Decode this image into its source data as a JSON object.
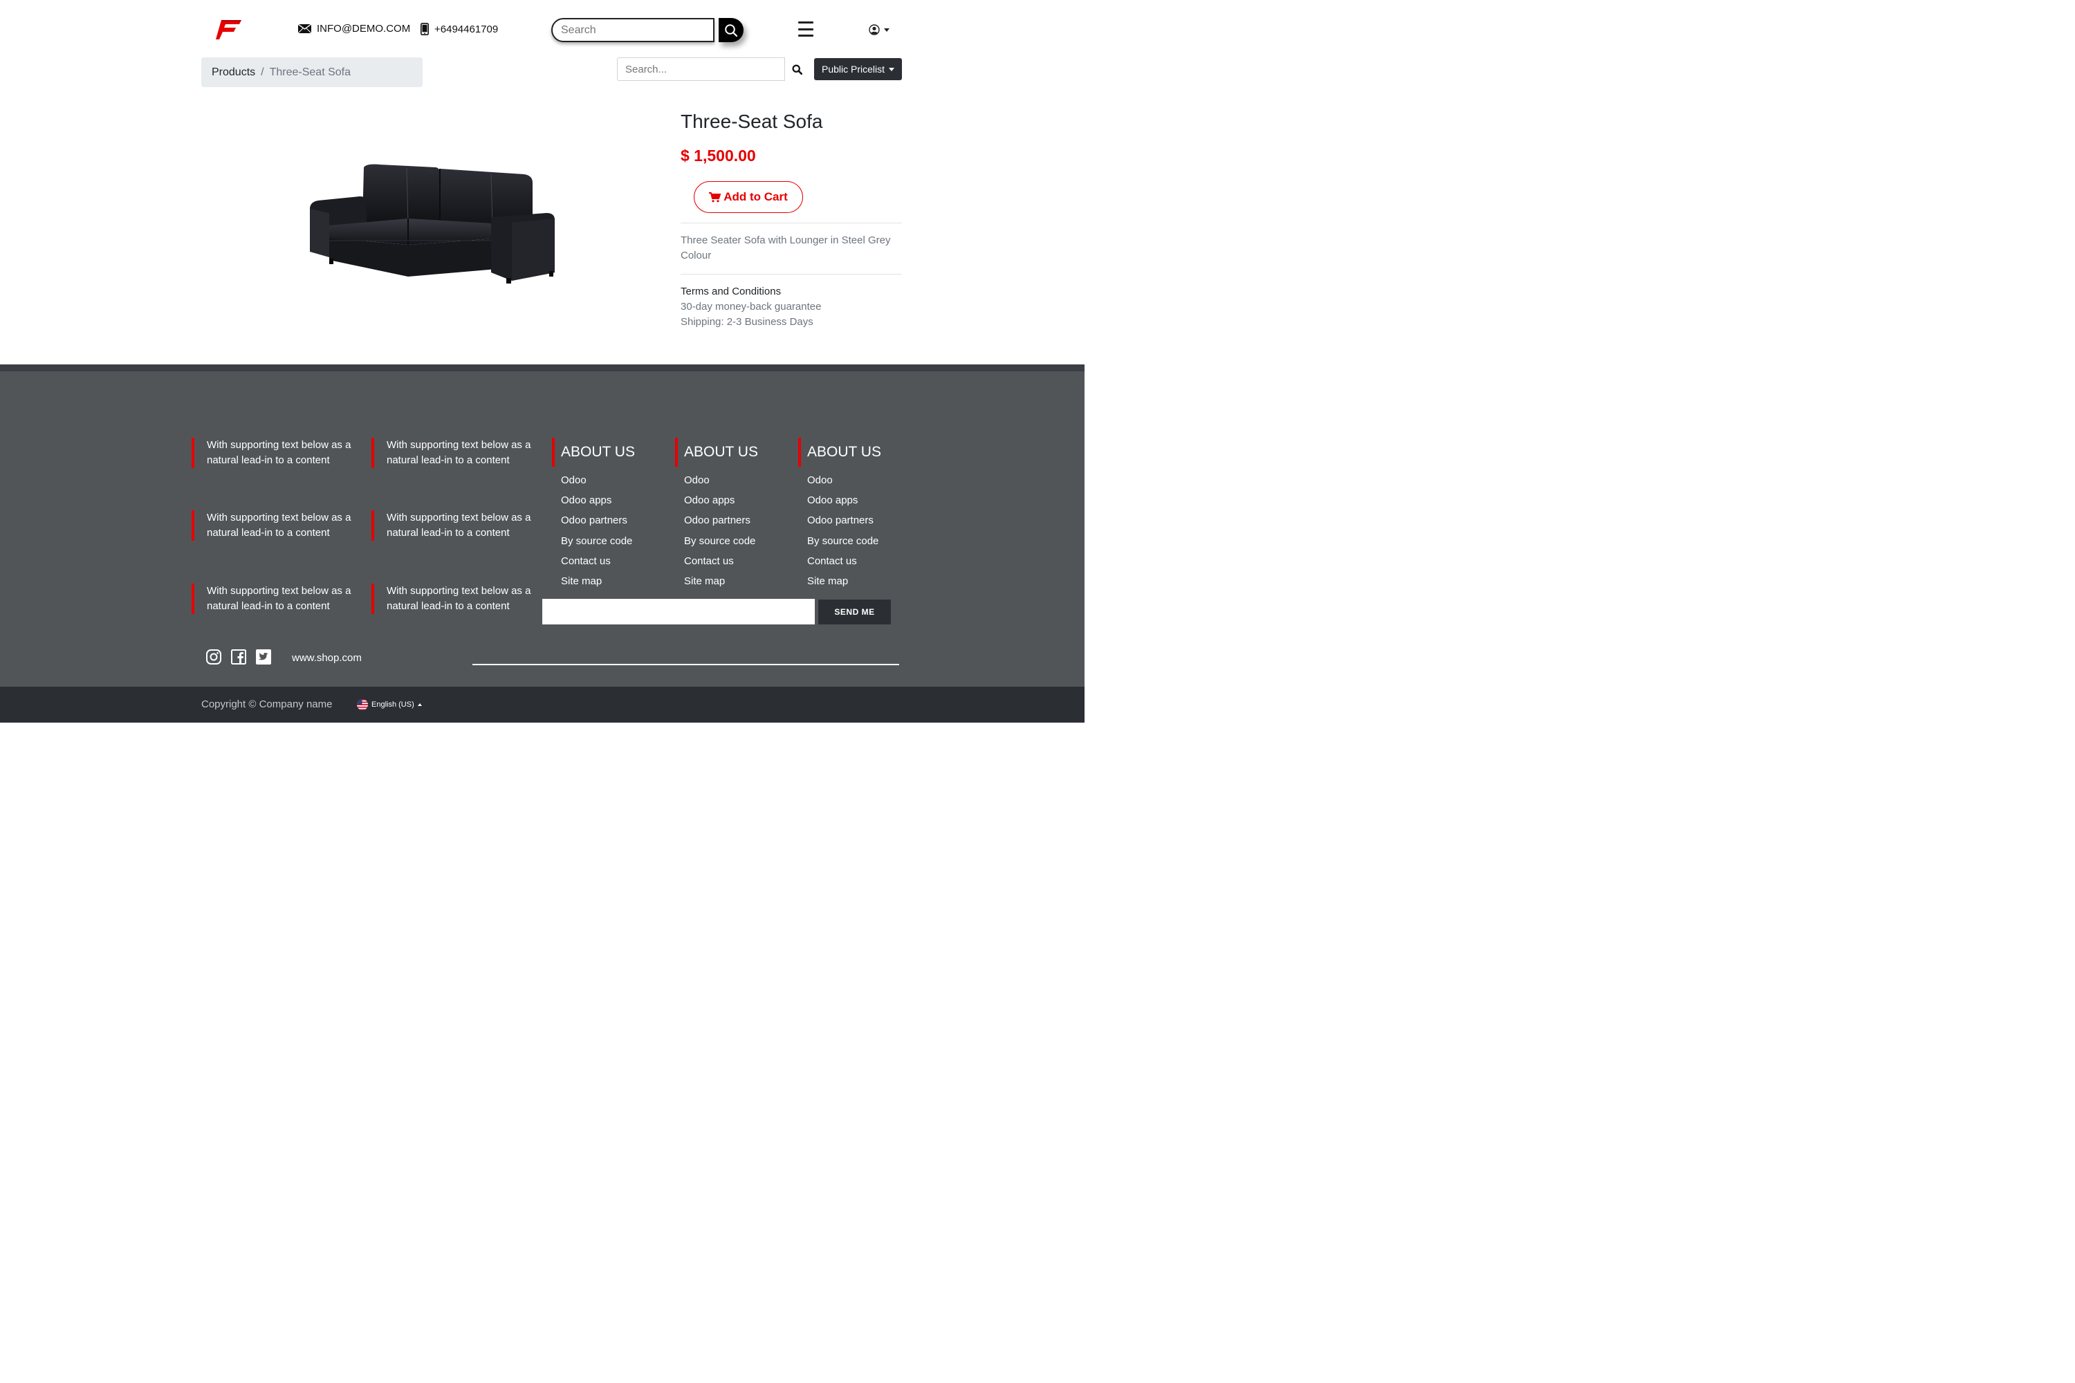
{
  "header": {
    "email": "INFO@DEMO.COM",
    "phone": "+6494461709",
    "search_placeholder": "Search"
  },
  "breadcrumb": {
    "parent": "Products",
    "separator": "/",
    "current": "Three-Seat Sofa"
  },
  "product_search": {
    "placeholder": "Search..."
  },
  "pricelist": {
    "label": "Public Pricelist"
  },
  "product": {
    "name": "Three-Seat Sofa",
    "price": "$ 1,500.00",
    "add_to_cart": "Add to Cart",
    "description": "Three Seater Sofa with Lounger in Steel Grey Colour",
    "terms_title": "Terms and Conditions",
    "terms_lines": [
      "30-day money-back guarantee",
      "Shipping: 2-3 Business Days"
    ]
  },
  "footer": {
    "features": [
      "With supporting text below as a natural lead-in to a content",
      "With supporting text below as a natural lead-in to a content",
      "With supporting text below as a natural lead-in to a content",
      "With supporting text below as a natural lead-in to a content",
      "With supporting text below as a natural lead-in to a content",
      "With supporting text below as a natural lead-in to a content"
    ],
    "columns": [
      {
        "title": "ABOUT US",
        "links": [
          "Odoo",
          "Odoo apps",
          "Odoo partners",
          "By source code",
          "Contact us",
          "Site map"
        ]
      },
      {
        "title": "ABOUT US",
        "links": [
          "Odoo",
          "Odoo apps",
          "Odoo partners",
          "By source code",
          "Contact us",
          "Site map"
        ]
      },
      {
        "title": "ABOUT US",
        "links": [
          "Odoo",
          "Odoo apps",
          "Odoo partners",
          "By source code",
          "Contact us",
          "Site map"
        ]
      }
    ],
    "send_label": "SEND ME",
    "shop_url": "www.shop.com",
    "copyright": "Copyright © Company name",
    "language": "English (US)"
  },
  "icons": {
    "mail": "envelope-icon",
    "phone": "mobile-phone-icon",
    "search": "magnifier-icon",
    "menu": "hamburger-icon",
    "user": "user-circle-icon",
    "cart": "shopping-cart-icon",
    "social": [
      "instagram-icon",
      "facebook-icon",
      "twitter-icon"
    ],
    "flag": "us-flag-icon"
  },
  "colors": {
    "accent": "#e60000",
    "footer_bg": "#525558",
    "bottom_bar": "#2b2e33"
  }
}
